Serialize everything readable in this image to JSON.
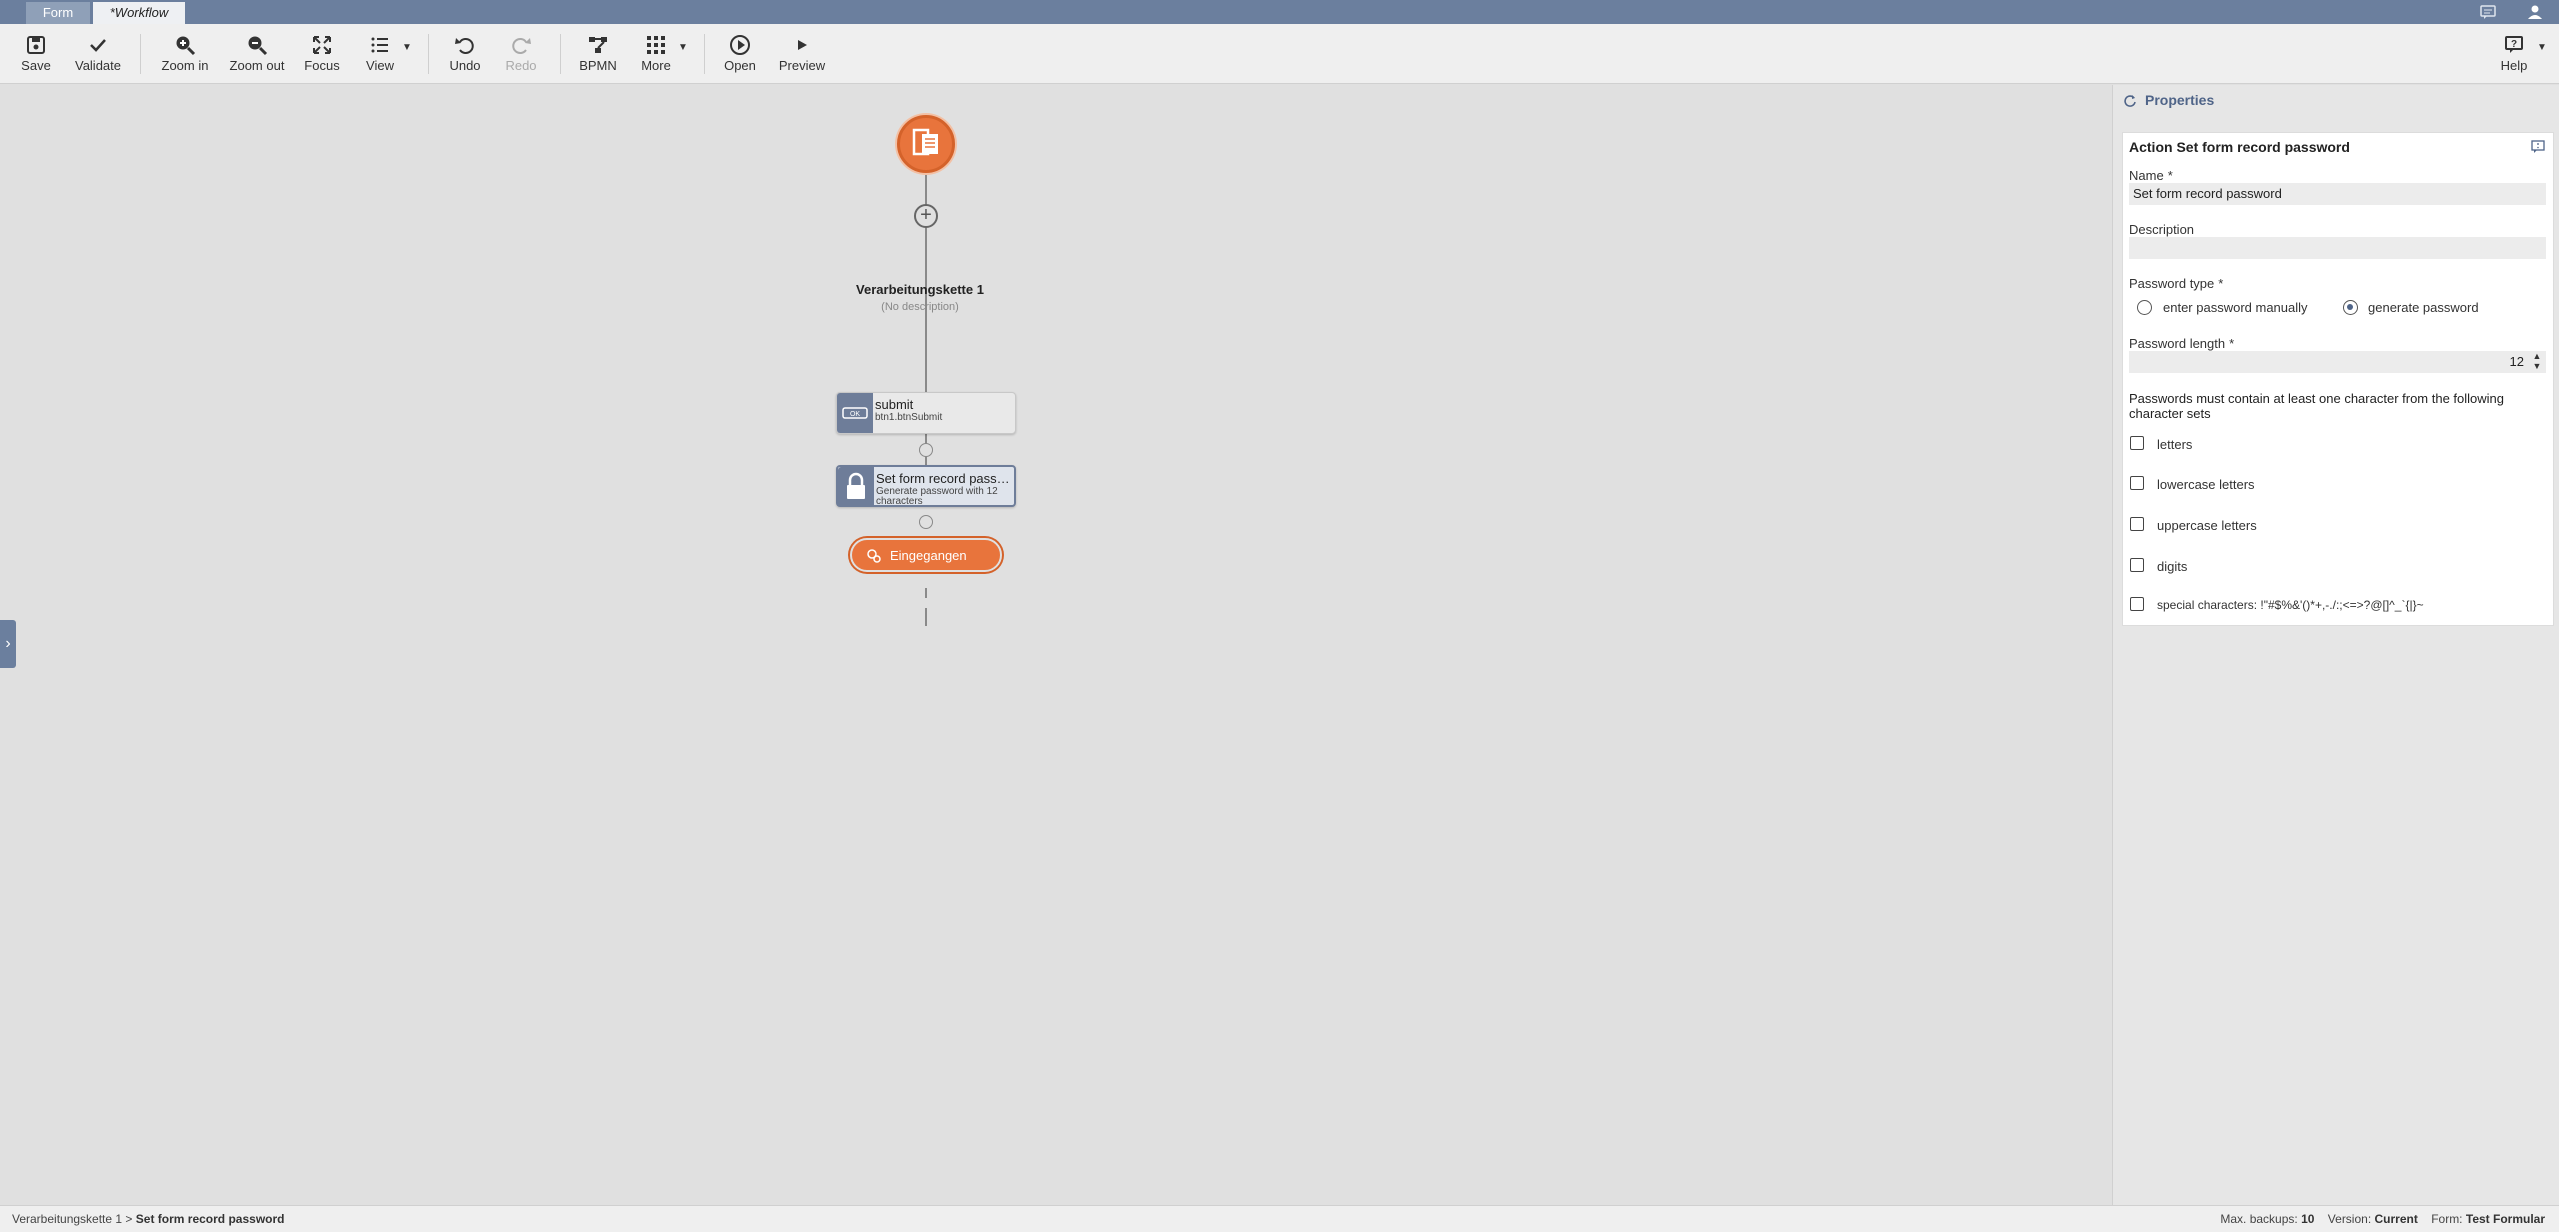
{
  "tabs": [
    {
      "label": "Form"
    },
    {
      "label": "*Workflow"
    }
  ],
  "toolbar": {
    "save": "Save",
    "validate": "Validate",
    "zoom_in": "Zoom in",
    "zoom_out": "Zoom out",
    "focus": "Focus",
    "view": "View",
    "undo": "Undo",
    "redo": "Redo",
    "bpmn": "BPMN",
    "more": "More",
    "open": "Open",
    "preview": "Preview",
    "help": "Help"
  },
  "canvas": {
    "chain_title": "Verarbeitungskette 1",
    "chain_desc": "(No description)",
    "nodes": [
      {
        "title": "submit",
        "subtitle": "btn1.btnSubmit"
      },
      {
        "title": "Set form record passwo...",
        "subtitle": "Generate password with 12 characters"
      }
    ],
    "end_label": "Eingegangen"
  },
  "properties": {
    "header": "Properties",
    "card_title": "Action Set form record password",
    "name_label": "Name",
    "name_required": "*",
    "name_value": "Set form record password",
    "description_label": "Description",
    "description_value": "",
    "password_type_label": "Password type",
    "password_type_required": "*",
    "password_type_options": [
      "enter password manually",
      "generate password"
    ],
    "password_type_selected": "generate password",
    "password_length_label": "Password length",
    "password_length_required": "*",
    "password_length_value": "12",
    "hint": "Passwords must contain at least one character from the following character sets",
    "charsets": [
      {
        "label": "letters",
        "checked": false
      },
      {
        "label": "lowercase letters",
        "checked": false
      },
      {
        "label": "uppercase letters",
        "checked": false
      },
      {
        "label": "digits",
        "checked": false
      },
      {
        "label": "special characters: !\"#$%&'()*+,-./:;<=>?@[]^_`{|}~",
        "checked": false
      }
    ]
  },
  "status": {
    "breadcrumb_parent": "Verarbeitungskette 1",
    "breadcrumb_sep": ">",
    "breadcrumb_current": "Set form record password",
    "max_backups_label": "Max. backups:",
    "max_backups_value": "10",
    "version_label": "Version:",
    "version_value": "Current",
    "form_label": "Form:",
    "form_value": "Test Formular"
  },
  "colors": {
    "accent": "#6b7f9e",
    "orange": "#e8743c",
    "panel_title": "#4f6488"
  }
}
